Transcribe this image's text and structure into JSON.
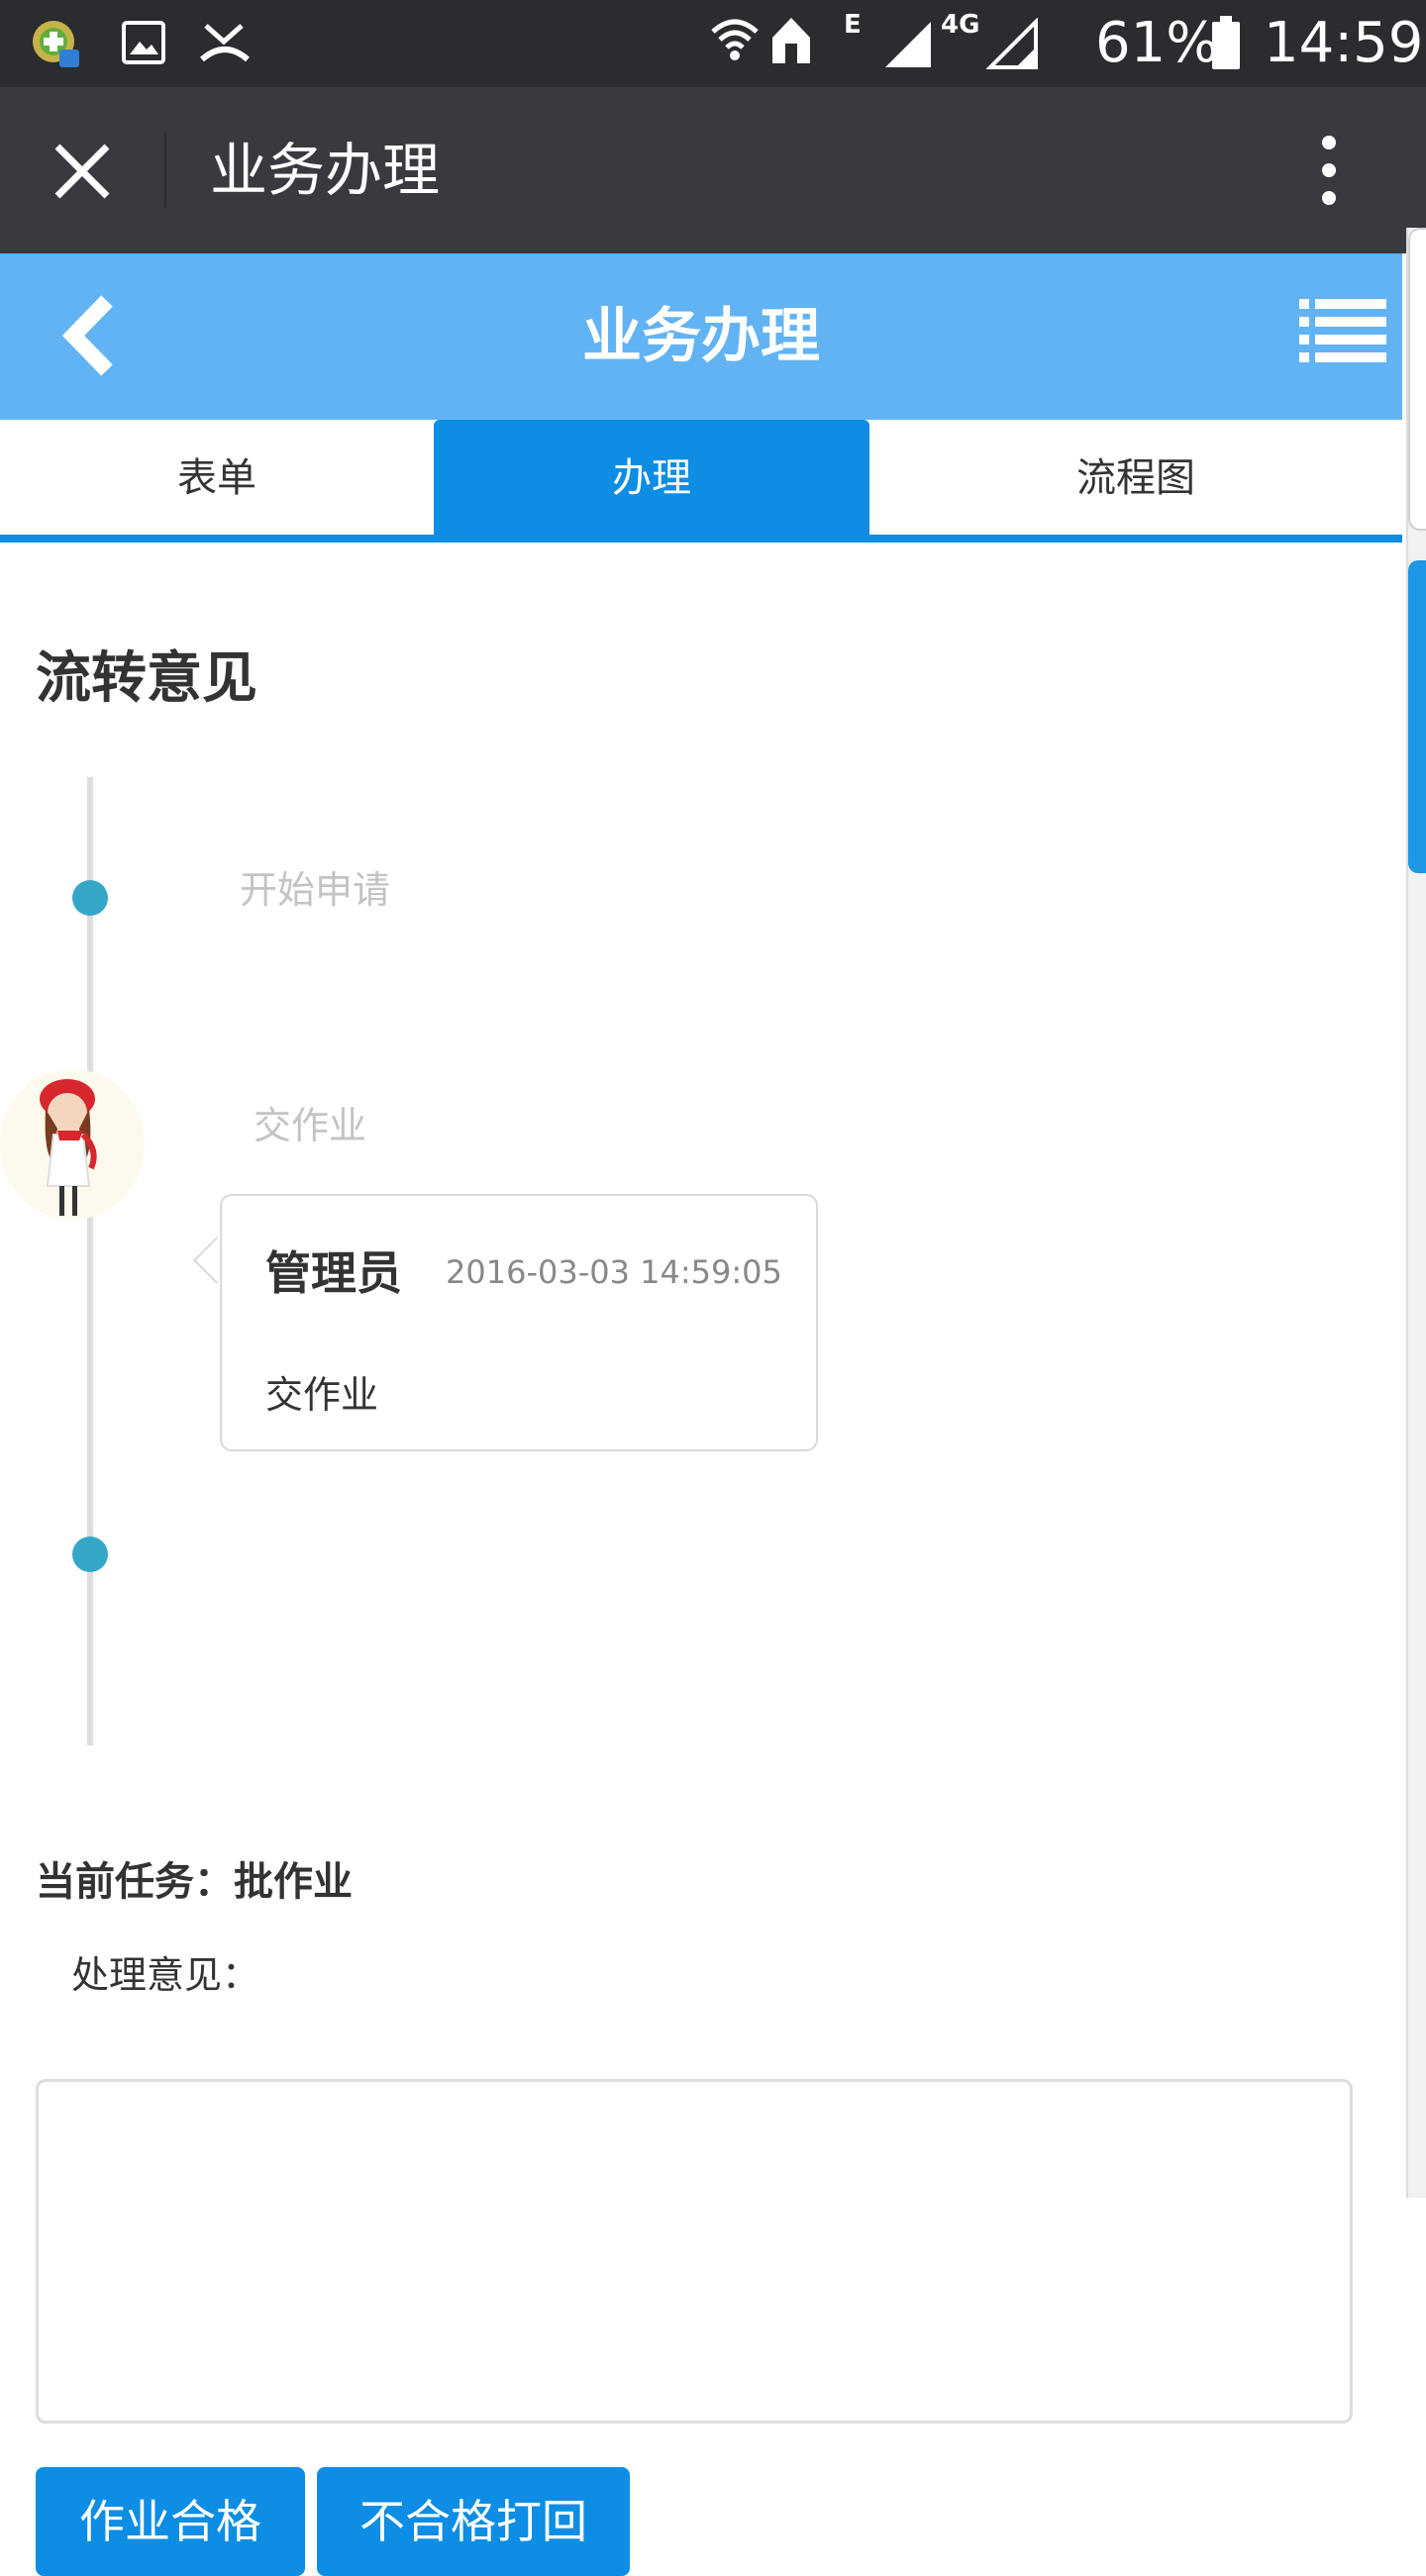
{
  "status_bar": {
    "battery": "61%",
    "time": "14:59",
    "network": "4G",
    "signal_e": "E"
  },
  "wechat_header": {
    "title": "业务办理"
  },
  "app_header": {
    "title": "业务办理"
  },
  "tabs": [
    {
      "label": "表单",
      "active": false
    },
    {
      "label": "办理",
      "active": true
    },
    {
      "label": "流程图",
      "active": false
    }
  ],
  "flow": {
    "section_title": "流转意见",
    "steps": [
      {
        "label": "开始申请"
      },
      {
        "label": "交作业"
      }
    ],
    "comment": {
      "author": "管理员",
      "time": "2016-03-03 14:59:05",
      "text": "交作业"
    }
  },
  "task": {
    "current_task": "当前任务：批作业",
    "opinion_label": "处理意见：",
    "opinion_value": ""
  },
  "actions": {
    "pass_label": "作业合格",
    "reject_label": "不合格打回"
  },
  "colors": {
    "accent": "#0d8de3",
    "app_header": "#61b3f3",
    "wechat_header": "#393a3f",
    "timeline_dot": "#34a7c9"
  }
}
